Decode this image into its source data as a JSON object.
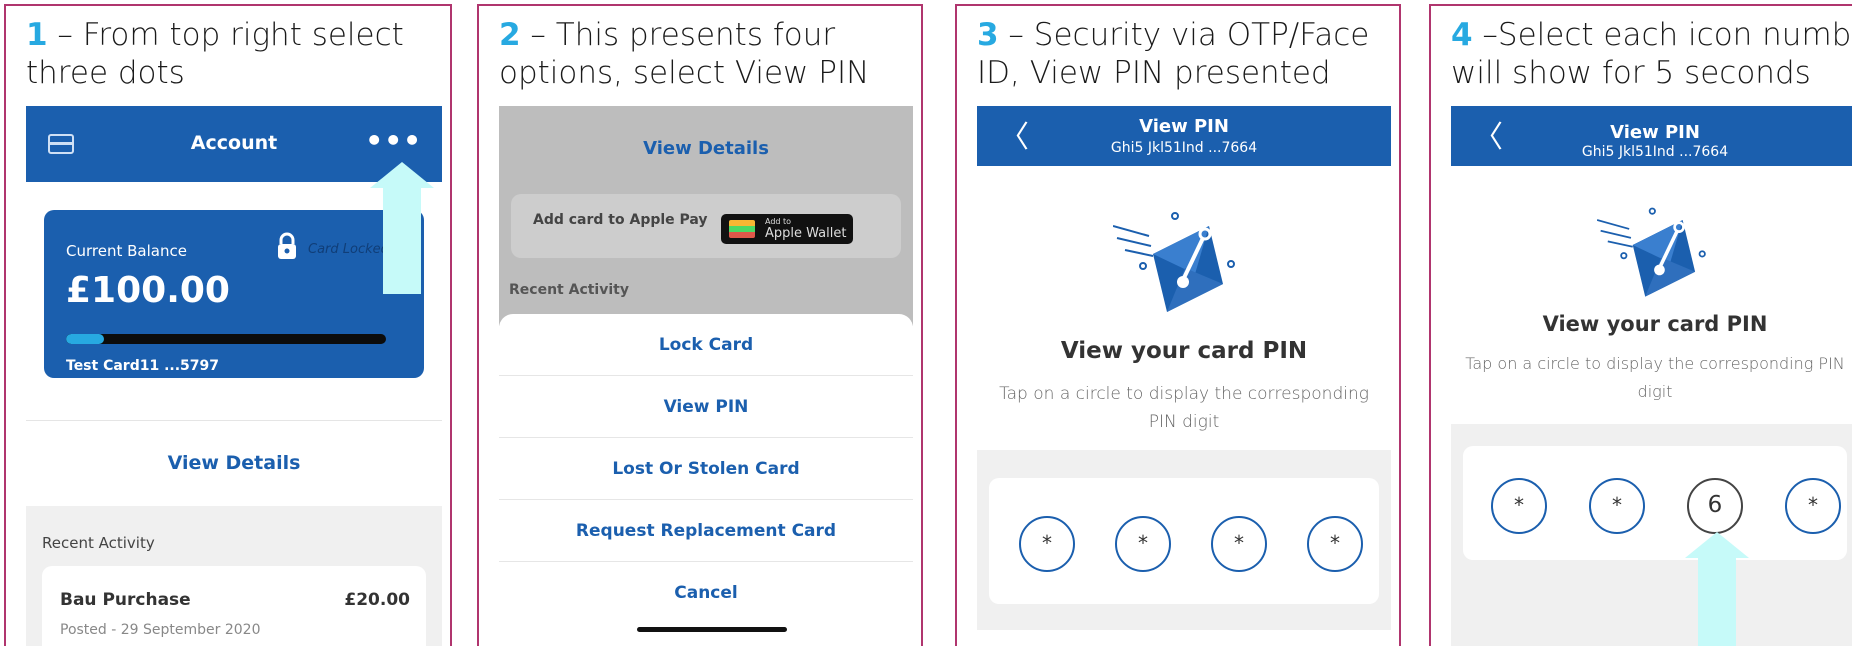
{
  "steps": [
    {
      "num": "1",
      "line1": " – From top right select",
      "line2": "three dots"
    },
    {
      "num": "2",
      "line1": " – This presents four",
      "line2": "options, select View PIN"
    },
    {
      "num": "3",
      "line1": " – Security via OTP/Face",
      "line2": "ID, View PIN presented"
    },
    {
      "num": "4",
      "line1": " –Select each icon number",
      "line2": "will show for 5 seconds"
    }
  ],
  "account": {
    "title": "Account",
    "menu_icon": "more-dots-icon",
    "dots": "•••",
    "balance_label": "Current Balance",
    "balance": "£100.00",
    "balance_progress": 0.12,
    "lock_label": "Card Locked",
    "card_name": "Test Card11 ...5797",
    "view_details": "View Details",
    "recent_activity": "Recent Activity",
    "transaction": {
      "name": "Bau Purchase",
      "amount": "£20.00",
      "posted": "Posted  - 29 September 2020"
    }
  },
  "options": {
    "view_details": "View Details",
    "apple_pay_label": "Add card to Apple Pay",
    "wallet_small": "Add to",
    "wallet_big": "Apple Wallet",
    "recent_activity": "Recent Activity",
    "items": [
      "Lock Card",
      "View PIN",
      "Lost Or Stolen Card",
      "Request Replacement Card",
      "Cancel"
    ]
  },
  "view_pin": {
    "title": "View PIN",
    "subtitle": "Ghi5 Jkl51Ind ...7664",
    "back": "〈",
    "heading": "View your card PIN",
    "description": "Tap on a circle to display the corresponding PIN digit",
    "hidden_digit": "*",
    "revealed_digit": "6"
  },
  "colors": {
    "brand": "#1b5fae",
    "accent": "#27a9e1",
    "frame": "#b0356e",
    "arrow": "#c6faf9"
  }
}
